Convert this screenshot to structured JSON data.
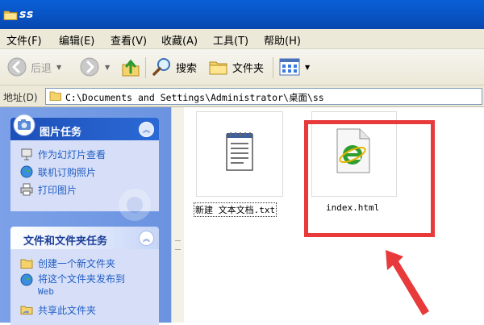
{
  "window": {
    "title": "ss"
  },
  "menu": {
    "items": [
      "文件(F)",
      "编辑(E)",
      "查看(V)",
      "收藏(A)",
      "工具(T)",
      "帮助(H)"
    ]
  },
  "toolbar": {
    "back_label": "后退",
    "search_label": "搜索",
    "folders_label": "文件夹"
  },
  "address": {
    "label": "地址(D)",
    "value": "C:\\Documents and Settings\\Administrator\\桌面\\ss"
  },
  "tasks": {
    "picture_tasks": {
      "title": "图片任务",
      "items": [
        "作为幻灯片查看",
        "联机订购照片",
        "打印图片"
      ]
    },
    "file_folder_tasks": {
      "title": "文件和文件夹任务",
      "items": [
        {
          "line1": "创建一个新文件夹"
        },
        {
          "line1": "将这个文件夹发布到",
          "line2": "Web"
        },
        {
          "line1": "共享此文件夹"
        }
      ]
    }
  },
  "files": [
    {
      "name": "新建 文本文档.txt",
      "icon": "notepad-icon"
    },
    {
      "name": "index.html",
      "icon": "ie-html-icon"
    }
  ],
  "colors": {
    "titlebar": "#0853c4",
    "taskpane": "#7ca1e8",
    "link": "#215dc6",
    "highlight": "#e8393b"
  }
}
